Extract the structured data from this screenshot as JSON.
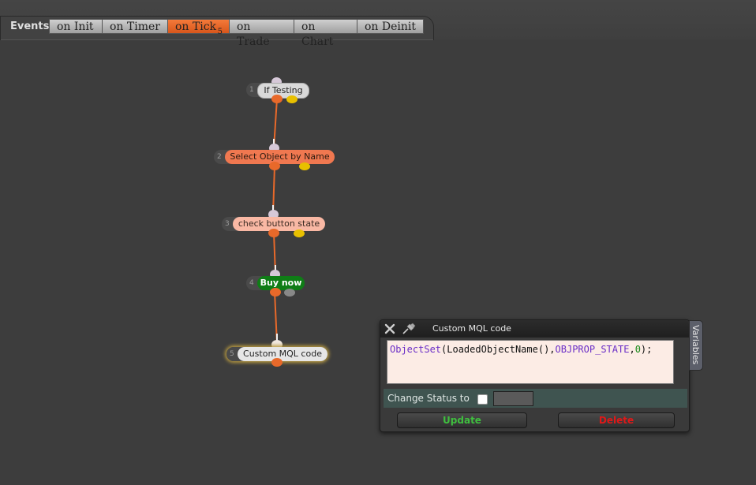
{
  "header": {
    "events_label": "Events",
    "tabs": [
      {
        "label": "on Init",
        "count": ""
      },
      {
        "label": "on Timer",
        "count": ""
      },
      {
        "label": "on Tick",
        "count": "5"
      },
      {
        "label": "on Trade",
        "count": ""
      },
      {
        "label": "on Chart",
        "count": ""
      },
      {
        "label": "on Deinit",
        "count": ""
      }
    ],
    "active_tab": "on Tick"
  },
  "flow": {
    "nodes": [
      {
        "num": "1",
        "label": "If Testing",
        "color": "#d9d9d9",
        "text_color": "#222222"
      },
      {
        "num": "2",
        "label": "Select Object by Name",
        "color": "#f07850",
        "text_color": "#2a1a10"
      },
      {
        "num": "3",
        "label": "check button state",
        "color": "#f9b8a4",
        "text_color": "#3a2a22"
      },
      {
        "num": "4",
        "label": "Buy now",
        "color": "#0f7d16",
        "text_color": "#ffffff"
      },
      {
        "num": "5",
        "label": "Custom MQL code",
        "color": "#e6e6e6",
        "text_color": "#222222"
      }
    ],
    "connector_color": "#e8692a"
  },
  "panel": {
    "title": "Custom MQL code",
    "code": {
      "fn": "ObjectSet",
      "p1": "(LoadedObjectName(),",
      "const": "OBJPROP_STATE",
      "p2": ",",
      "num": "0",
      "p3": ");"
    },
    "status_label": "Change Status to",
    "update_label": "Update",
    "delete_label": "Delete",
    "variables_label": "Variables"
  },
  "colors": {
    "background": "#3d3d3d",
    "accent": "#e8692a",
    "update_text": "#3fbf3f",
    "delete_text": "#e01818"
  }
}
